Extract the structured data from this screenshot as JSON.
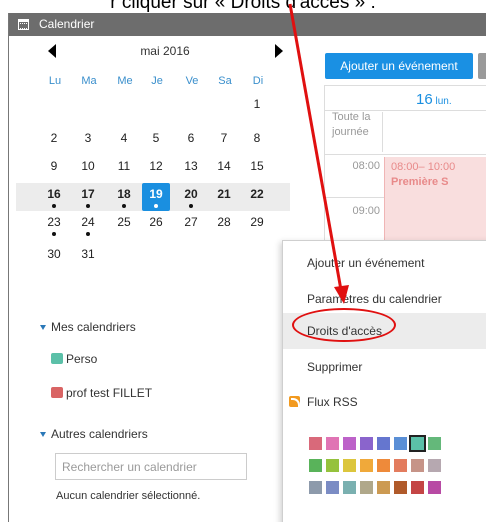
{
  "caption": "r cliquer sur « Droits d'accès » :",
  "window": {
    "title": "Calendrier"
  },
  "mini_calendar": {
    "month_label": "mai 2016",
    "weekdays": [
      "Lu",
      "Ma",
      "Me",
      "Je",
      "Ve",
      "Sa",
      "Di"
    ],
    "weeks": [
      [
        "",
        "",
        "",
        "",
        "",
        "",
        "1"
      ],
      [
        "2",
        "3",
        "4",
        "5",
        "6",
        "7",
        "8"
      ],
      [
        "9",
        "10",
        "11",
        "12",
        "13",
        "14",
        "15"
      ],
      [
        "16",
        "17",
        "18",
        "19",
        "20",
        "21",
        "22"
      ],
      [
        "23",
        "24",
        "25",
        "26",
        "27",
        "28",
        "29"
      ],
      [
        "30",
        "31",
        "",
        "",
        "",
        "",
        ""
      ]
    ],
    "current_week_index": 3,
    "today": "19",
    "days_with_events": [
      "16",
      "17",
      "18",
      "19",
      "20",
      "23",
      "24"
    ]
  },
  "sidebar": {
    "my_calendars_label": "Mes calendriers",
    "my_calendars": [
      {
        "name": "Perso",
        "color": "#5bc0a8"
      },
      {
        "name": "prof test FILLET",
        "color": "#d96464"
      }
    ],
    "other_calendars_label": "Autres calendriers",
    "search_placeholder": "Rechercher un calendrier",
    "no_calendar_text": "Aucun calendrier sélectionné."
  },
  "day_view": {
    "add_event_button": "Ajouter un événement",
    "day_number": "16",
    "day_name": "lun.",
    "all_day_label": "Toute la journée",
    "hours": [
      "08:00",
      "09:00"
    ],
    "event": {
      "time": "08:00– 10:00",
      "title": "Première S",
      "color": "#f9dede"
    }
  },
  "context_menu": {
    "items": [
      "Ajouter un événement",
      "Paramètres du calendrier",
      "Droits d'accès",
      "Supprimer",
      "Flux RSS"
    ],
    "highlighted_item": "Droits d'accès",
    "rss_icon": "rss-icon",
    "palette": [
      [
        "#d9697a",
        "#e074b4",
        "#bd62c9",
        "#8a64cc",
        "#6576cf",
        "#5a8fd6",
        "#5bc0a8",
        "#64b87a"
      ],
      [
        "#59b35a",
        "#95c23c",
        "#dcc63d",
        "#f0a93a",
        "#ee8a3a",
        "#e37c5e",
        "#c69488",
        "#b6a8b0"
      ],
      [
        "#8d9aab",
        "#7b8cc4",
        "#7ab0b0",
        "#b0a88a",
        "#cc9a52",
        "#b05a2a",
        "#c44545",
        "#b84aa4"
      ]
    ],
    "selected_color": "#5bc0a8"
  }
}
